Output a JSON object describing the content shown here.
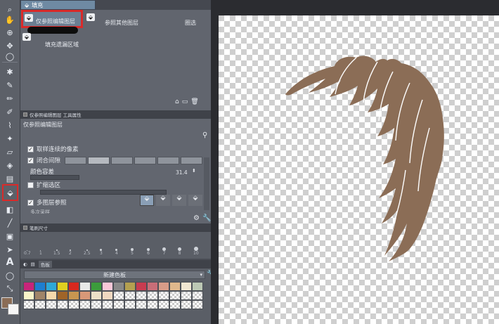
{
  "subtool": {
    "tab_label": "填充",
    "items": [
      "仅参照编辑图层",
      "参照其他图层",
      "填充遗漏区域"
    ],
    "item_icons": [
      "fill-bucket-icon",
      "fill-bucket-icon",
      "fill-bucket-icon"
    ],
    "item2_suffix": "圈选",
    "bottom_icons": [
      "home-icon",
      "new-subtool-icon",
      "trash-icon"
    ]
  },
  "tool_property": {
    "panel_title": "仅参照编辑图层 工具属性",
    "header": "仅参照编辑图层",
    "options": [
      {
        "label": "取样连续的像素",
        "checked": true
      },
      {
        "label": "闭合间隙",
        "checked": true
      },
      {
        "label": "颜色容差",
        "value": "31.4"
      },
      {
        "label": "扩缩选区",
        "checked": false
      },
      {
        "label": "多图层参照",
        "checked": true
      }
    ],
    "cut_label": "多次采样"
  },
  "brush_size": {
    "title": "笔刷尺寸",
    "sizes": [
      "0.7",
      "1",
      "1.5",
      "2",
      "2.5",
      "3",
      "4",
      "5",
      "6",
      "7",
      "8",
      "10"
    ]
  },
  "color_set": {
    "tab_label": "色板",
    "name": "新建色板",
    "swatches": [
      "#c8247a",
      "#1e7ed0",
      "#2ea8d8",
      "#e0d020",
      "#d8281e",
      "#e8e8e8",
      "#3c9c3c",
      "#fac8d8",
      "#888888",
      "#b4a050",
      "#c83c50",
      "#c86e78",
      "#d89c88",
      "#e0b88c",
      "#f0e6d2",
      "#bcc8b4",
      "#f8f4c8",
      "#a08468",
      "#f4d8ac",
      "#a06428",
      "#c89650",
      "#d89878",
      "#ece0c8",
      "#f0d8c0"
    ],
    "foreground": "#8b6d56",
    "background": "#f6f6f6"
  },
  "canvas": {
    "hair_color": "#8b6d56"
  }
}
